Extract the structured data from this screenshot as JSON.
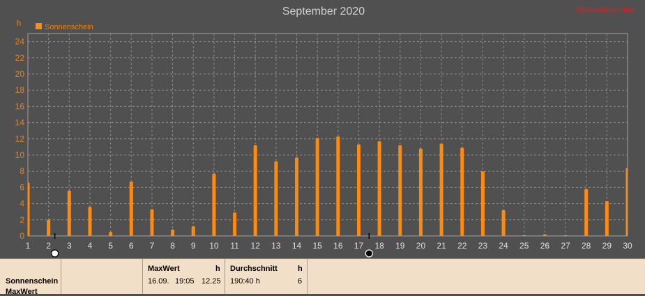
{
  "header": {
    "title": "September 2020",
    "brand_text": "Wetterstation Hain",
    "unit_label": "h",
    "legend_label": "Sonnenschein"
  },
  "colors": {
    "bar": "#ff8a10",
    "background": "#505050",
    "grid": "#8c8c8c",
    "panel": "#f2dfc8"
  },
  "chart_data": {
    "type": "bar",
    "title": "September 2020",
    "ylabel": "h",
    "xlabel": "",
    "legend": [
      "Sonnenschein"
    ],
    "legend_position": "top-left",
    "grid": true,
    "xlim": [
      1,
      30
    ],
    "ylim": [
      0,
      25
    ],
    "y_ticks": [
      0,
      2,
      4,
      6,
      8,
      10,
      12,
      14,
      16,
      18,
      20,
      22,
      24
    ],
    "categories": [
      1,
      2,
      3,
      4,
      5,
      6,
      7,
      8,
      9,
      10,
      11,
      12,
      13,
      14,
      15,
      16,
      17,
      18,
      19,
      20,
      21,
      22,
      23,
      24,
      25,
      26,
      27,
      28,
      29,
      30
    ],
    "series": [
      {
        "name": "Sonnenschein",
        "values": [
          6.6,
          2.0,
          5.6,
          3.6,
          0.5,
          6.7,
          3.3,
          0.8,
          1.2,
          7.7,
          2.9,
          11.2,
          9.2,
          9.7,
          12.1,
          12.3,
          11.3,
          11.7,
          11.2,
          10.8,
          11.4,
          10.9,
          8.0,
          3.2,
          0.1,
          0.2,
          0.1,
          5.8,
          4.3,
          8.4
        ]
      }
    ],
    "markers": [
      {
        "day": 2,
        "symbol": "full-moon"
      },
      {
        "day": 17.5,
        "symbol": "new-moon"
      }
    ]
  },
  "panel": {
    "series_name": "Sonnenschein",
    "series_sub": "MaxWert",
    "max": {
      "header": "MaxWert",
      "unit": "h",
      "date": "16.09.",
      "time": "19:05",
      "value": "12.25"
    },
    "avg": {
      "header": "Durchschnitt",
      "unit": "h",
      "total": "190:40 h",
      "value": "6"
    }
  }
}
